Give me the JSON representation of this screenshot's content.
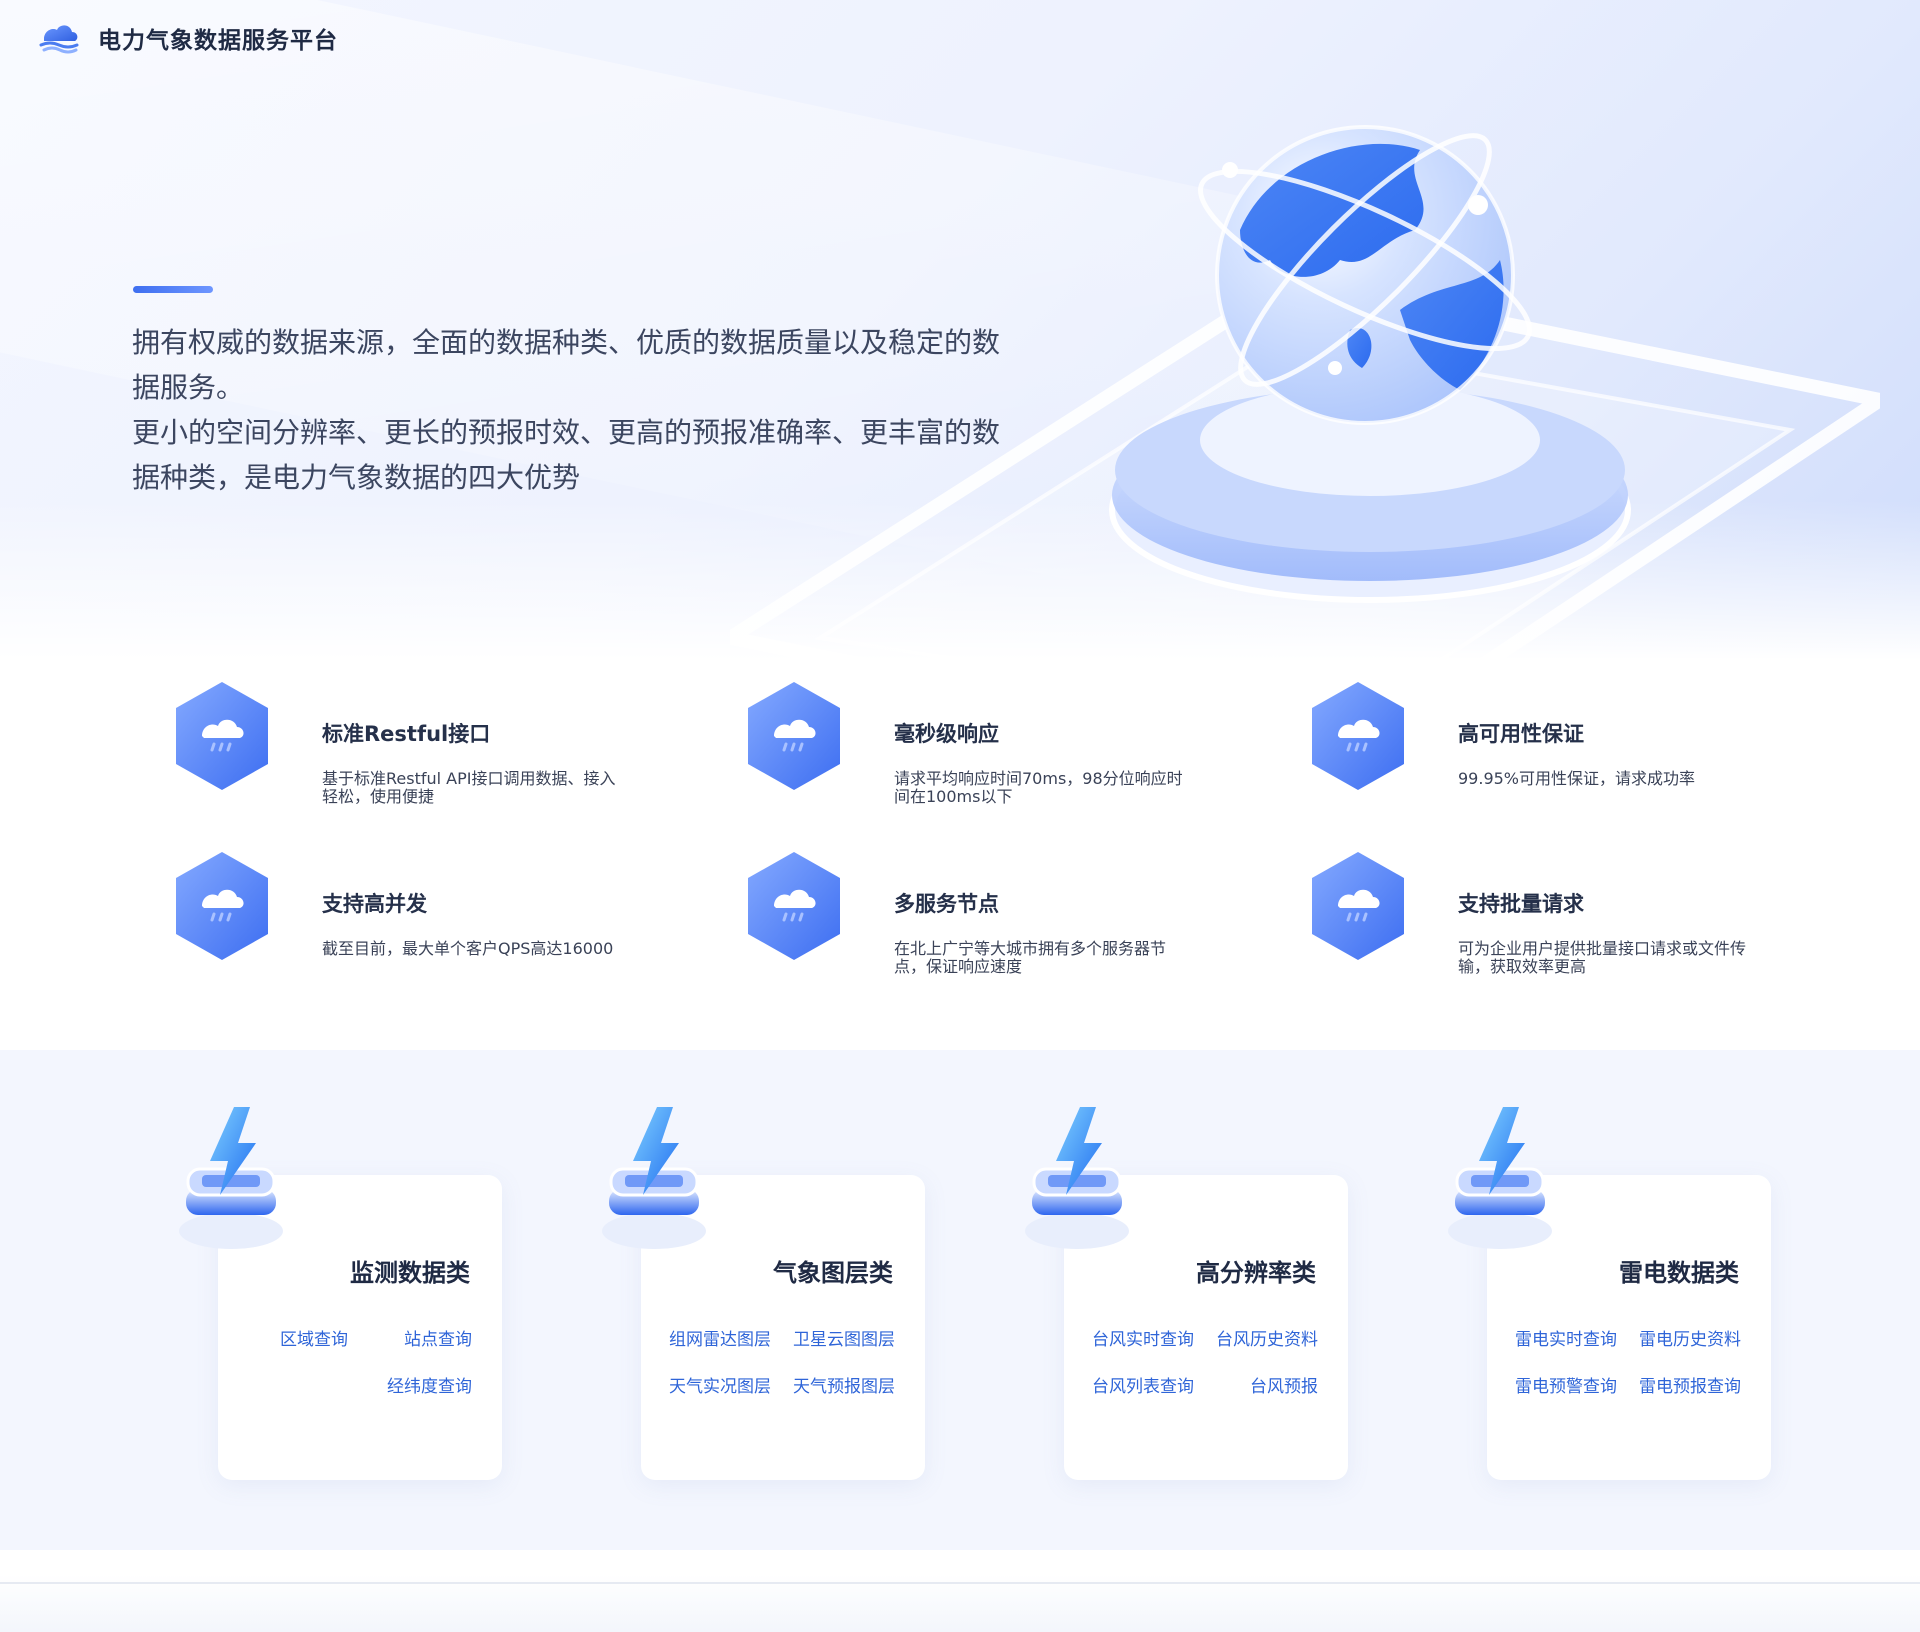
{
  "header": {
    "title": "电力气象数据服务平台",
    "logo": "cloud-logo-icon"
  },
  "hero": {
    "lines": [
      "拥有权威的数据来源，全面的数据种类、优质的数据质量以及稳定的数据服务。",
      "更小的空间分辨率、更长的预报时效、更高的预报准确率、更丰富的数据种类，是电力气象数据的四大优势"
    ],
    "illustration": "globe-icon"
  },
  "features": [
    {
      "title": "标准Restful接口",
      "desc": "基于标准Restful API接口调用数据、接入轻松，使用便捷",
      "icon": "cloud-rain-icon"
    },
    {
      "title": "毫秒级响应",
      "desc": "请求平均响应时间70ms，98分位响应时间在100ms以下",
      "icon": "cloud-rain-icon"
    },
    {
      "title": "高可用性保证",
      "desc": "99.95%可用性保证，请求成功率",
      "icon": "cloud-rain-icon"
    },
    {
      "title": "支持高并发",
      "desc": "截至目前，最大单个客户QPS高达16000",
      "icon": "cloud-rain-icon"
    },
    {
      "title": "多服务节点",
      "desc": "在北上广宁等大城市拥有多个服务器节点，保证响应速度",
      "icon": "cloud-rain-icon"
    },
    {
      "title": "支持批量请求",
      "desc": "可为企业用户提供批量接口请求或文件传输，获取效率更高",
      "icon": "cloud-rain-icon"
    }
  ],
  "categories": [
    {
      "title": "监测数据类",
      "links": [
        "区域查询",
        "站点查询",
        "",
        "经纬度查询"
      ],
      "icon": "lightning-server-icon"
    },
    {
      "title": "气象图层类",
      "links": [
        "组网雷达图层",
        "卫星云图图层",
        "天气实况图层",
        "天气预报图层"
      ],
      "icon": "lightning-server-icon"
    },
    {
      "title": "高分辨率类",
      "links": [
        "台风实时查询",
        "台风历史资料",
        "台风列表查询",
        "台风预报"
      ],
      "icon": "lightning-server-icon"
    },
    {
      "title": "雷电数据类",
      "links": [
        "雷电实时查询",
        "雷电历史资料",
        "雷电预警查询",
        "雷电预报查询"
      ],
      "icon": "lightning-server-icon"
    }
  ],
  "colors": {
    "accent": "#3e6ff0",
    "link": "#2f65d8",
    "title": "#1f2a44",
    "cat_bg": "#f3f6fe"
  }
}
